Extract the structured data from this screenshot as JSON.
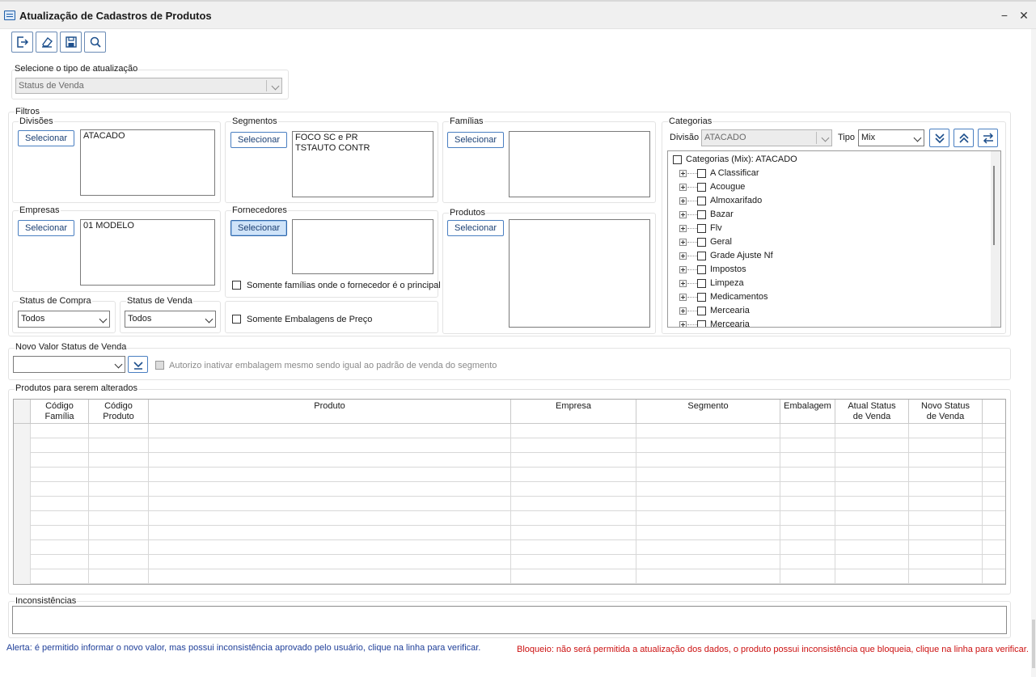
{
  "window": {
    "title": "Atualização de Cadastros de Produtos",
    "minimize": "−",
    "close": "✕"
  },
  "toolbar": {
    "icons": [
      "exit-icon",
      "eraser-icon",
      "save-icon",
      "search-icon"
    ]
  },
  "update_type": {
    "label": "Selecione o tipo de atualização",
    "value": "Status de Venda"
  },
  "filters": {
    "label": "Filtros",
    "select_label": "Selecionar",
    "divisoes": {
      "label": "Divisões",
      "items": [
        "ATACADO"
      ]
    },
    "segmentos": {
      "label": "Segmentos",
      "items": [
        "FOCO SC e PR",
        "TSTAUTO CONTR"
      ]
    },
    "familias": {
      "label": "Famílias",
      "items": []
    },
    "empresas": {
      "label": "Empresas",
      "items": [
        "01 MODELO"
      ]
    },
    "fornecedores": {
      "label": "Fornecedores",
      "items": []
    },
    "produtos": {
      "label": "Produtos",
      "items": []
    },
    "somente_familias": "Somente famílias onde o fornecedor é o principal",
    "somente_embalagens": "Somente Embalagens de Preço",
    "status_compra": {
      "label": "Status de Compra",
      "value": "Todos"
    },
    "status_venda": {
      "label": "Status de Venda",
      "value": "Todos"
    }
  },
  "categorias": {
    "label": "Categorias",
    "divisao_label": "Divisão",
    "divisao_value": "ATACADO",
    "tipo_label": "Tipo",
    "tipo_value": "Mix",
    "root": "Categorias (Mix): ATACADO",
    "items": [
      "A Classificar",
      "Acougue",
      "Almoxarifado",
      "Bazar",
      "Flv",
      "Geral",
      "Grade Ajuste Nf",
      "Impostos",
      "Limpeza",
      "Medicamentos",
      "Mercearia",
      "Mercearia"
    ]
  },
  "novo_valor": {
    "label": "Novo Valor Status de Venda",
    "value": "",
    "autorizo": "Autorizo inativar embalagem mesmo sendo igual ao padrão de venda do segmento"
  },
  "produtos_grid": {
    "label": "Produtos para serem alterados",
    "columns": [
      "Código\nFamília",
      "Código\nProduto",
      "Produto",
      "Empresa",
      "Segmento",
      "Embalagem",
      "Atual Status\nde Venda",
      "Novo Status\nde Venda"
    ],
    "row_count": 11
  },
  "inconsistencias": {
    "label": "Inconsistências"
  },
  "footer": {
    "alerta": "Alerta: é permitido informar o novo valor, mas possui inconsistência aprovado pelo usuário, clique na linha para verificar.",
    "bloqueio": "Bloqueio: não será permitida a atualização dos dados, o produto possui inconsistência que bloqueia, clique na linha para verificar.",
    "alerta_color": "#1f3f99",
    "bloqueio_color": "#cc1111"
  }
}
